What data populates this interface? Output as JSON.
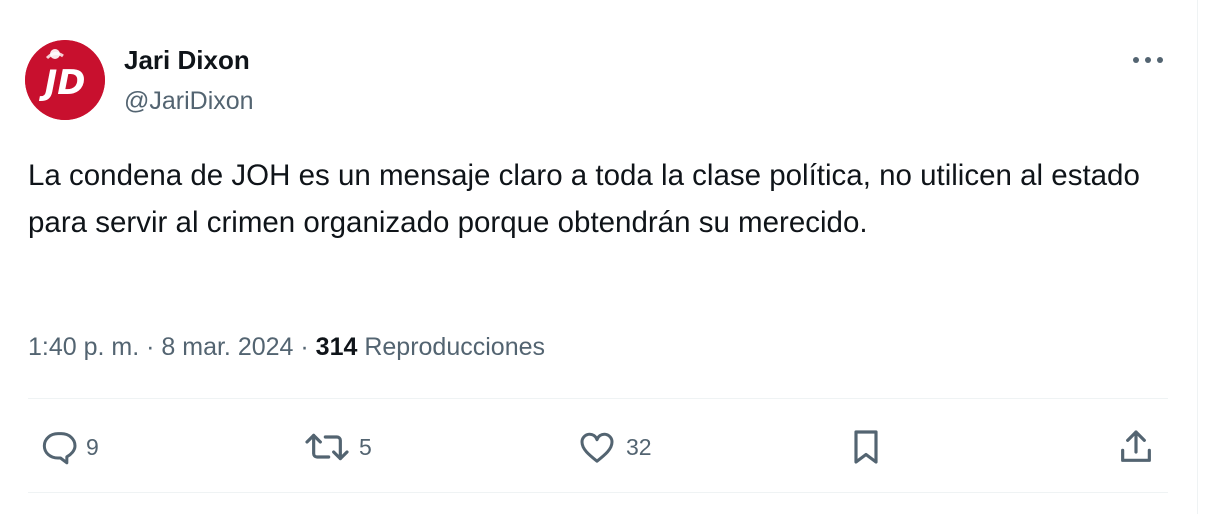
{
  "author": {
    "display_name": "Jari Dixon",
    "handle": "@JariDixon",
    "avatar_icon": "jd-logo-icon",
    "avatar_text": "JD",
    "avatar_color": "#c8102e"
  },
  "menu_icon": "more-horizontal-icon",
  "tweet": {
    "text": "La condena de JOH es un mensaje claro a toda la clase política, no utilicen al estado para servir al crimen organizado porque obtendrán su merecido."
  },
  "meta": {
    "time": "1:40 p. m.",
    "separator": "·",
    "date": "8 mar. 2024",
    "views_count": "314",
    "views_label": "Reproducciones"
  },
  "actions": {
    "reply": {
      "icon": "reply-icon",
      "count": "9"
    },
    "retweet": {
      "icon": "retweet-icon",
      "count": "5"
    },
    "like": {
      "icon": "heart-icon",
      "count": "32"
    },
    "bookmark": {
      "icon": "bookmark-icon"
    },
    "share": {
      "icon": "share-icon"
    }
  },
  "colors": {
    "text_primary": "#0f1419",
    "text_secondary": "#536471",
    "divider": "#eff3f4"
  }
}
